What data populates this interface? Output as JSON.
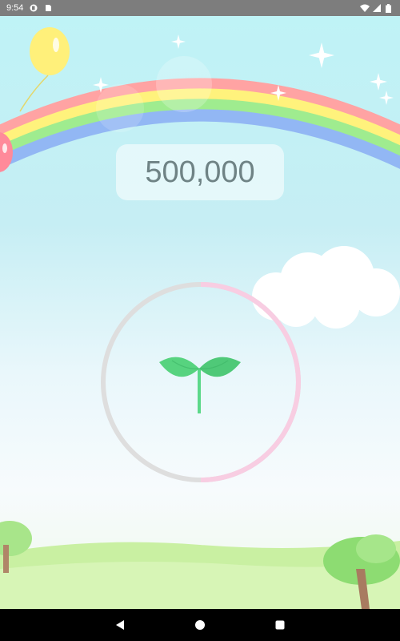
{
  "status_bar": {
    "time": "9:54",
    "left_icons": [
      "app-notification-icon",
      "sd-card-icon"
    ],
    "right_icons": [
      "wifi-icon",
      "signal-icon",
      "battery-icon"
    ]
  },
  "counter": {
    "value": "500,000"
  },
  "progress_ring": {
    "progress": 0.5,
    "track_color": "#dedede",
    "fill_color": "#f8cde2"
  },
  "center_icon": {
    "name": "sprout-icon",
    "color": "#4fd37a"
  },
  "nav_bar": {
    "buttons": [
      "back-icon",
      "home-icon",
      "recents-icon"
    ]
  },
  "colors": {
    "sky_top": "#bff3f6",
    "counter_text": "#6f8385"
  }
}
